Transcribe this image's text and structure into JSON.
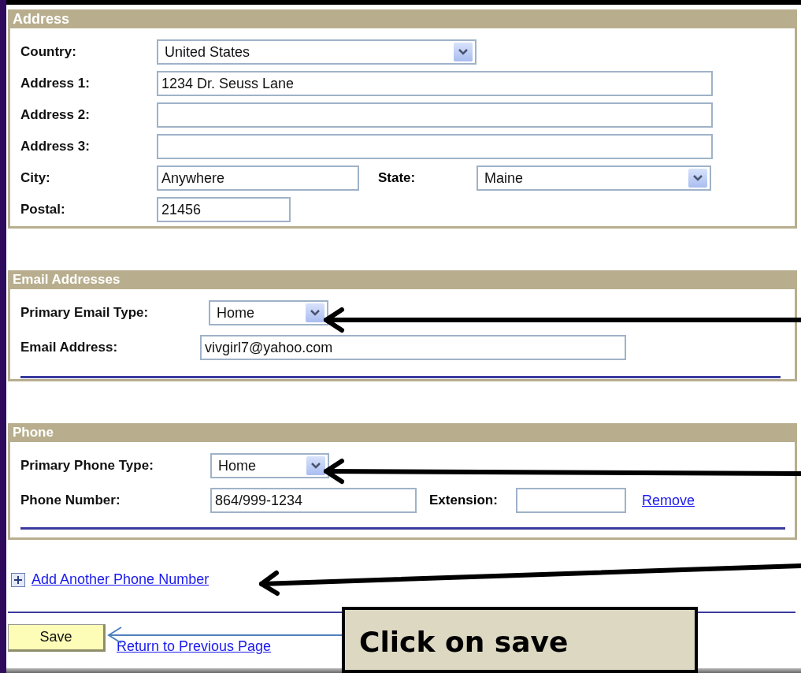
{
  "address": {
    "title": "Address",
    "rows": [
      {
        "label": "Country:",
        "kind": "select",
        "value": "United States"
      },
      {
        "label": "Address 1:",
        "kind": "text",
        "value": "1234 Dr. Seuss Lane"
      },
      {
        "label": "Address 2:",
        "kind": "text"
      },
      {
        "label": "Address 3:",
        "kind": "text"
      }
    ],
    "city": {
      "label": "City:",
      "value": "Anywhere"
    },
    "state": {
      "label": "State:",
      "value": "Maine"
    },
    "postal": {
      "label": "Postal:",
      "value": "21456"
    }
  },
  "email": {
    "title": "Email Addresses",
    "type_label": "Primary Email Type:",
    "type_value": "Home",
    "address_label": "Email Address:",
    "address_value": "vivgirl7@yahoo.com"
  },
  "phone": {
    "title": "Phone",
    "type_label": "Primary Phone Type:",
    "type_value": "Home",
    "number_label": "Phone Number:",
    "number_value": "864/999-1234",
    "extension_label": "Extension:",
    "remove_link": "Remove"
  },
  "add_phone_link": "Add Another Phone Number",
  "save_button": "Save",
  "return_link": "Return to Previous Page",
  "callout": "Click on save"
}
